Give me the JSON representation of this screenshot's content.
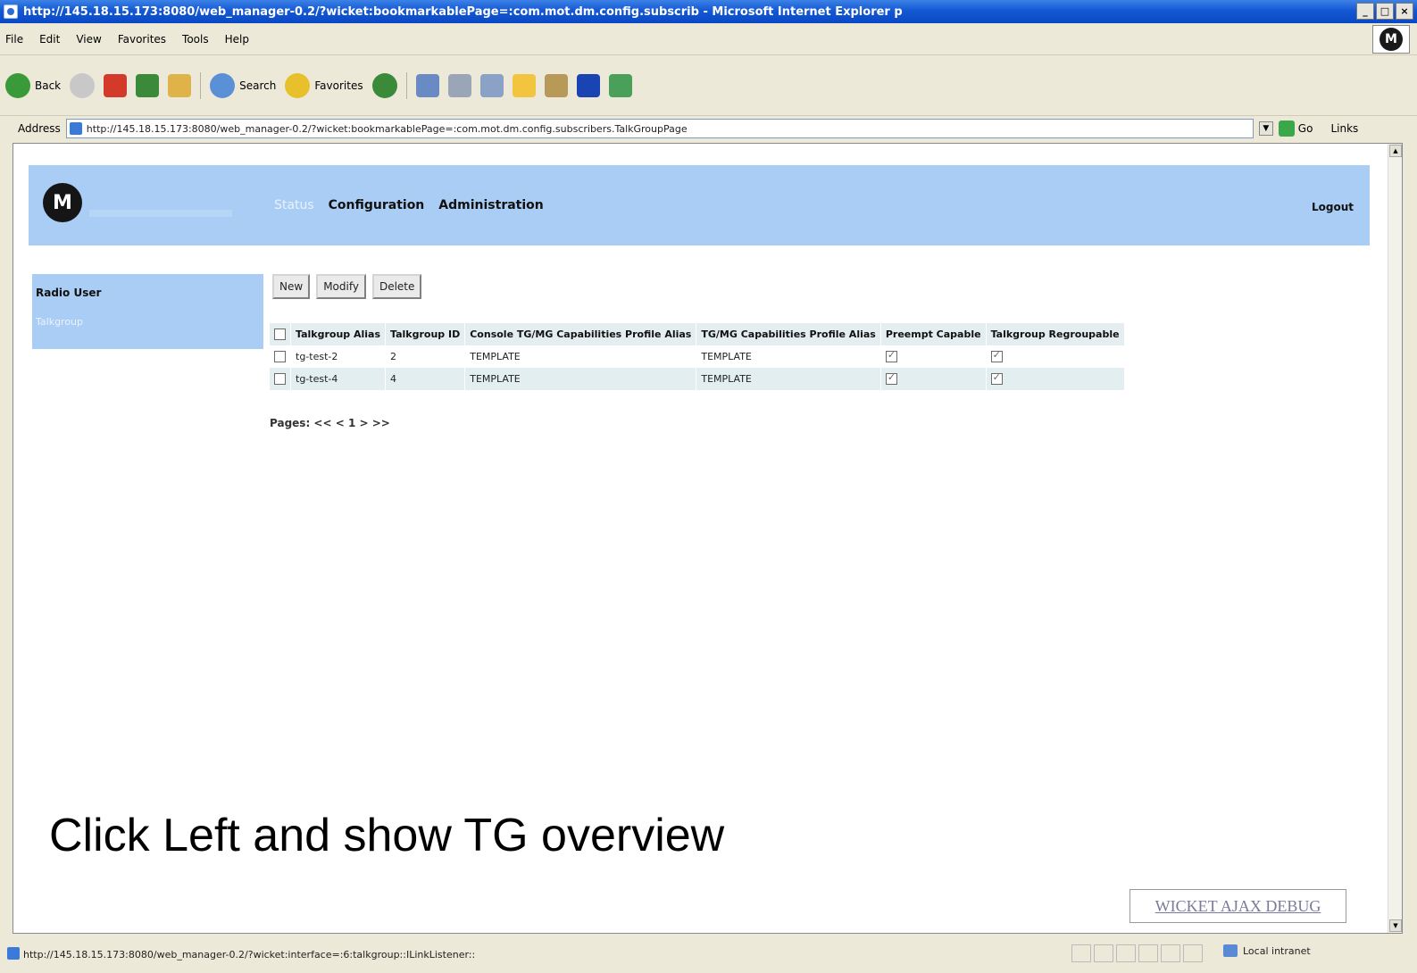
{
  "window": {
    "title": "http://145.18.15.173:8080/web_manager-0.2/?wicket:bookmarkablePage=:com.mot.dm.config.subscrib - Microsoft Internet Explorer p",
    "controls": {
      "minimize": "_",
      "maximize": "□",
      "close": "×"
    }
  },
  "menubar": {
    "items": [
      "File",
      "Edit",
      "View",
      "Favorites",
      "Tools",
      "Help"
    ],
    "brand_logo": "M"
  },
  "toolbar": {
    "back_label": "Back",
    "search_label": "Search",
    "favorites_label": "Favorites",
    "icons": [
      "back-icon",
      "forward-icon",
      "stop-icon",
      "refresh-icon",
      "home-icon",
      "search-icon",
      "favorites-icon",
      "history-icon",
      "mail-icon",
      "print-icon",
      "edit-icon",
      "folder-icon",
      "messenger-icon",
      "bluetooth-icon",
      "tools-icon"
    ]
  },
  "address": {
    "label": "Address",
    "url": "http://145.18.15.173:8080/web_manager-0.2/?wicket:bookmarkablePage=:com.mot.dm.config.subscribers.TalkGroupPage",
    "go_label": "Go",
    "links_label": "Links"
  },
  "app": {
    "logo": "M",
    "nav": {
      "status": "Status",
      "configuration": "Configuration",
      "administration": "Administration"
    },
    "logout": "Logout",
    "sidebar": {
      "radio_user": "Radio User",
      "talkgroup": "Talkgroup"
    },
    "buttons": {
      "new": "New",
      "modify": "Modify",
      "delete": "Delete"
    },
    "table": {
      "headers": [
        "Talkgroup Alias",
        "Talkgroup ID",
        "Console TG/MG Capabilities Profile Alias",
        "TG/MG Capabilities Profile Alias",
        "Preempt Capable",
        "Talkgroup Regroupable"
      ],
      "rows": [
        {
          "alias": "tg-test-2",
          "id": "2",
          "console_profile": "TEMPLATE",
          "profile": "TEMPLATE",
          "preempt": true,
          "regroupable": true
        },
        {
          "alias": "tg-test-4",
          "id": "4",
          "console_profile": "TEMPLATE",
          "profile": "TEMPLATE",
          "preempt": true,
          "regroupable": true
        }
      ]
    },
    "pages": "Pages: << < 1 > >>"
  },
  "caption": "Click Left and show TG overview",
  "debug_link": "WICKET AJAX DEBUG",
  "statusbar": {
    "text": "http://145.18.15.173:8080/web_manager-0.2/?wicket:interface=:6:talkgroup::ILinkListener::",
    "zone": "Local intranet"
  }
}
